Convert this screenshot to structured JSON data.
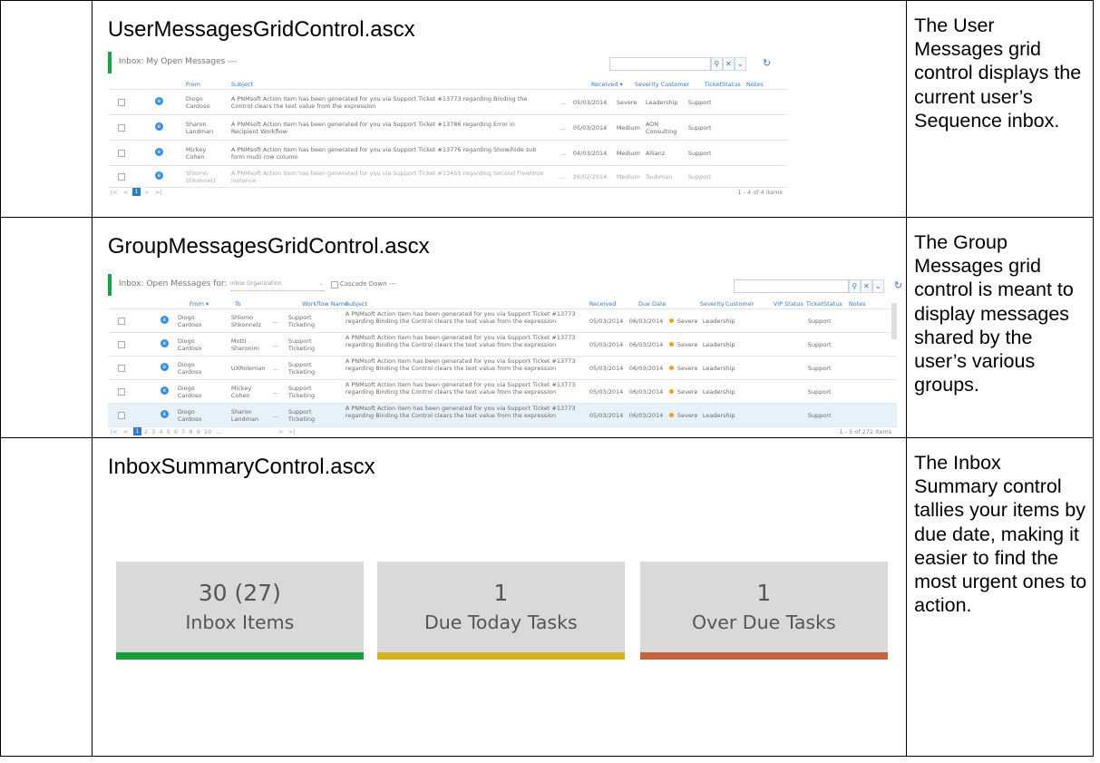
{
  "rows": [
    {
      "title": "UserMessagesGridControl.ascx",
      "description": "The User Messages grid control displays the current user’s Sequence inbox."
    },
    {
      "title": "GroupMessagesGridControl.ascx",
      "description": "The Group Messages grid control is meant to display messages shared by the user’s various groups."
    },
    {
      "title": "InboxSummaryControl.ascx",
      "description": "The Inbox Summary control tallies your items by due date, making it easier to find the most urgent ones to action."
    }
  ],
  "user_grid": {
    "header": "Inbox: My Open Messages  ---",
    "columns": {
      "from": "From",
      "subject": "Subject",
      "received": "Received ▾",
      "severity": "Severity",
      "customer": "Customer",
      "ticket_status": "TicketStatus",
      "notes": "Notes"
    },
    "rows": [
      {
        "from": "Diogo Cardoso",
        "subject": "A PNMsoft Action Item has been generated for you via Support Ticket #13773 regarding Binding the Control clears the text value from the expression",
        "received": "05/03/2014",
        "severity": "Severe",
        "customer": "Leadership",
        "status": "Support"
      },
      {
        "from": "Sharon Landman",
        "subject": "A PNMsoft Action Item has been generated for you via Support Ticket #13786 regarding Error in Recipient Workflow",
        "received": "05/03/2014",
        "severity": "Medium",
        "customer": "AON Consulting",
        "status": "Support"
      },
      {
        "from": "Mickey Cohen",
        "subject": "A PNMsoft Action Item has been generated for you via Support Ticket #13776 regarding Show/hide sub form multi row column",
        "received": "04/03/2014",
        "severity": "Medium",
        "customer": "Allianz",
        "status": "Support"
      },
      {
        "from": "Shlomo Shkonnelz",
        "subject": "A PNMsoft Action Item has been generated for you via Support Ticket #13455 regarding Second Flowtime instance",
        "received": "26/02/2014",
        "severity": "Medium",
        "customer": "Taubman",
        "status": "Support"
      }
    ],
    "pager_count": "1 - 4 of 4 items"
  },
  "group_grid": {
    "header": "Inbox: Open Messages for:",
    "org_select": "Inbox Organization",
    "cascade": "Cascade Down  ---",
    "columns": {
      "from": "From ▾",
      "to": "To",
      "workflow": "Workflow Name",
      "subject": "Subject",
      "received": "Received",
      "due": "Due Date",
      "severity": "Severity",
      "customer": "Customer",
      "vip": "VIP Status",
      "ticket_status": "TicketStatus",
      "notes": "Notes"
    },
    "rows": [
      {
        "from": "Diogo Cardoso",
        "to": "Shlomo Shkonnelz",
        "workflow": "Support Ticketing",
        "received": "05/03/2014",
        "due": "06/03/2014",
        "severity": "Severe",
        "customer": "Leadership",
        "status": "Support"
      },
      {
        "from": "Diogo Cardoso",
        "to": "Motti Sharonim",
        "workflow": "Support Ticketing",
        "received": "05/03/2014",
        "due": "06/03/2014",
        "severity": "Severe",
        "customer": "Leadership",
        "status": "Support"
      },
      {
        "from": "Diogo Cardoso",
        "to": "UXRoleman",
        "workflow": "Support Ticketing",
        "received": "05/03/2014",
        "due": "06/03/2014",
        "severity": "Severe",
        "customer": "Leadership",
        "status": "Support"
      },
      {
        "from": "Diogo Cardoso",
        "to": "Mickey Cohen",
        "workflow": "Support Ticketing",
        "received": "05/03/2014",
        "due": "06/03/2014",
        "severity": "Severe",
        "customer": "Leadership",
        "status": "Support"
      },
      {
        "from": "Diogo Cardoso",
        "to": "Sharon Landman",
        "workflow": "Support Ticketing",
        "received": "05/03/2014",
        "due": "06/03/2014",
        "severity": "Severe",
        "customer": "Leadership",
        "status": "Support"
      }
    ],
    "subject": "A PNMsoft Action Item has been generated for you via Support Ticket #13773 regarding Binding the Control clears the text value from the expression",
    "pages": "2  3  4  5  6  7  8  9  10  ...",
    "pager_count": "1 - 5 of 272 items"
  },
  "summary": [
    {
      "value": "30 (27)",
      "label": "Inbox Items",
      "color": "#17a03a"
    },
    {
      "value": "1",
      "label": "Due Today Tasks",
      "color": "#d7b11e"
    },
    {
      "value": "1",
      "label": "Over Due Tasks",
      "color": "#c9623c"
    }
  ]
}
